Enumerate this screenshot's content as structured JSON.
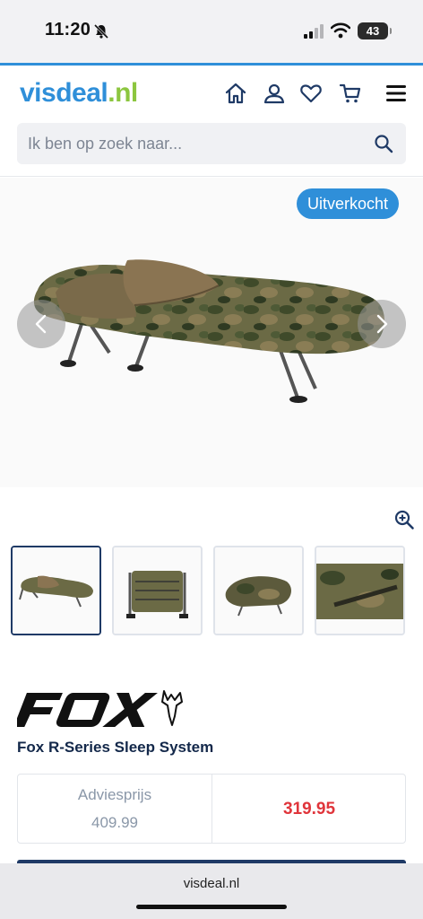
{
  "status_bar": {
    "time": "11:20",
    "battery": "43"
  },
  "header": {
    "logo_part1": "visdeal",
    "logo_part2": ".nl",
    "icons": [
      "home-icon",
      "user-icon",
      "heart-icon",
      "cart-icon",
      "menu-icon"
    ]
  },
  "search": {
    "placeholder": "Ik ben op zoek naar..."
  },
  "gallery": {
    "badge": "Uitverkocht",
    "thumbnail_count": 4,
    "active_thumbnail": 1
  },
  "product": {
    "brand": "FOX",
    "title": "Fox R-Series Sleep System"
  },
  "price": {
    "advies_label": "Adviesprijs",
    "advies_value": "409.99",
    "sale_price": "319.95"
  },
  "browser": {
    "url": "visdeal.nl"
  },
  "colors": {
    "accent_blue": "#2f8fd9",
    "logo_green": "#8cc63f",
    "sale_red": "#e0353b",
    "navy": "#1f3a66"
  }
}
